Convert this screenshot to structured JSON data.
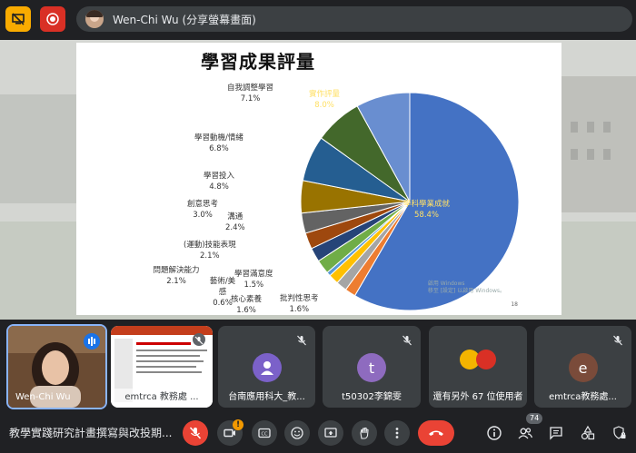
{
  "topbar": {
    "presenter_name": "Wen-Chi Wu",
    "presenter_status": "(分享螢幕畫面)"
  },
  "slide": {
    "title": "學習成果評量",
    "page_number": "18",
    "watermark": "啟用 Windows\n移至 [設定] 以啟用 Windows。",
    "pie_labels": [
      {
        "name": "學科學業成就",
        "pct": "58.4%"
      },
      {
        "name": "批判性思考",
        "pct": "1.6%"
      },
      {
        "name": "核心素養",
        "pct": "1.6%"
      },
      {
        "name": "學習滿意度",
        "pct": "1.5%"
      },
      {
        "name": "藝術/美感",
        "pct": "0.6%"
      },
      {
        "name": "問題解決能力",
        "pct": "2.1%"
      },
      {
        "name": "(運動)技能表現",
        "pct": "2.1%"
      },
      {
        "name": "溝通",
        "pct": "2.4%"
      },
      {
        "name": "創意思考",
        "pct": "3.0%"
      },
      {
        "name": "學習投入",
        "pct": "4.8%"
      },
      {
        "name": "學習動機/情緒",
        "pct": "6.8%"
      },
      {
        "name": "自我調整學習",
        "pct": "7.1%"
      },
      {
        "name": "實作評量",
        "pct": "8.0%"
      }
    ]
  },
  "chart_data": {
    "type": "pie",
    "title": "學習成果評量",
    "slices": [
      {
        "label": "學科學業成就",
        "value": 58.4,
        "color": "#4472c4"
      },
      {
        "label": "批判性思考",
        "value": 1.6,
        "color": "#ed7d31"
      },
      {
        "label": "核心素養",
        "value": 1.6,
        "color": "#a5a5a5"
      },
      {
        "label": "學習滿意度",
        "value": 1.5,
        "color": "#ffc000"
      },
      {
        "label": "藝術/美感",
        "value": 0.6,
        "color": "#5b9bd5"
      },
      {
        "label": "問題解決能力",
        "value": 2.1,
        "color": "#70ad47"
      },
      {
        "label": "(運動)技能表現",
        "value": 2.1,
        "color": "#264478"
      },
      {
        "label": "溝通",
        "value": 2.4,
        "color": "#9e480e"
      },
      {
        "label": "創意思考",
        "value": 3.0,
        "color": "#636363"
      },
      {
        "label": "學習投入",
        "value": 4.8,
        "color": "#997300"
      },
      {
        "label": "學習動機/情緒",
        "value": 6.8,
        "color": "#255e91"
      },
      {
        "label": "自我調整學習",
        "value": 7.1,
        "color": "#43682b"
      },
      {
        "label": "實作評量",
        "value": 8.0,
        "color": "#698ed0"
      }
    ]
  },
  "participants": [
    {
      "name": "Wen-Chi Wu",
      "speaking": true
    },
    {
      "name": "emtrca 教務處 ...",
      "screen": true
    },
    {
      "name": "台南應用科大_教...",
      "initial": "",
      "color": "#7b61c9"
    },
    {
      "name": "t50302李錦雯",
      "initial": "t",
      "color": "#8e6bbf"
    },
    {
      "name": "還有另外 67 位使用者"
    },
    {
      "name": "emtrca教務處...",
      "initial": "e",
      "color": "#7a4b3a"
    }
  ],
  "bottombar": {
    "meeting_title": "教學實踐研究計畫撰寫與改投期...",
    "participant_count": "74",
    "alert_badge": "!"
  }
}
